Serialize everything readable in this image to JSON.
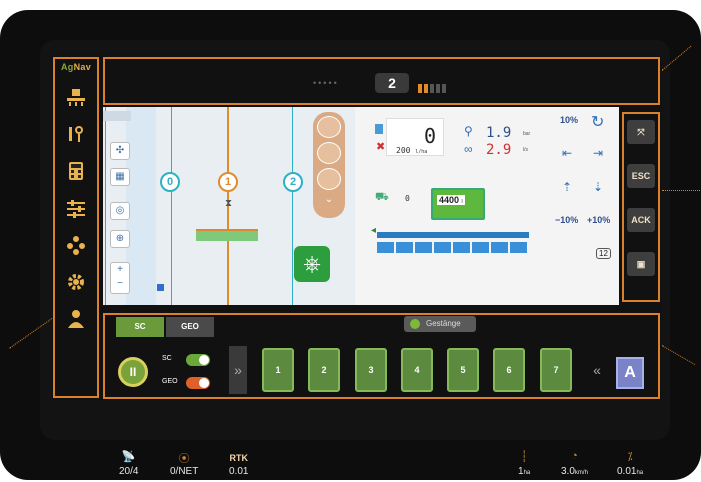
{
  "brand": {
    "logo_left": "Ag",
    "logo_right": "Nav"
  },
  "sidebar": {
    "items": [
      {
        "name": "implement-icon"
      },
      {
        "name": "io-icon"
      },
      {
        "name": "calculator-icon"
      },
      {
        "name": "sliders-icon"
      },
      {
        "name": "nodes-icon"
      },
      {
        "name": "gear-icon"
      },
      {
        "name": "user-icon"
      }
    ]
  },
  "topbar": {
    "satellites": "20/4",
    "ntrip": "0/NET",
    "rtk_label": "RTK",
    "rtk_value": "0.01",
    "lane_number": "2",
    "lane_bars": [
      1,
      1,
      0,
      0,
      0
    ],
    "field_value": "1",
    "field_unit": "ha",
    "speed_value": "3.0",
    "speed_unit": "km/h",
    "rate_value": "0.01",
    "rate_unit": "ha"
  },
  "map": {
    "tracks": [
      "0",
      "1",
      "2"
    ],
    "zoom_in": "+",
    "zoom_out": "−"
  },
  "panel": {
    "total": "0",
    "rate": "200",
    "rate_unit": "l/ha",
    "pressure": "1.9",
    "pressure_unit": "bar",
    "flow": "2.9",
    "flow_unit": "l/s",
    "sections_on": "0",
    "tank_volume": "4400",
    "tank_unit": "l",
    "pct_a": "10%",
    "pct_b": "10%",
    "count": "12"
  },
  "right": {
    "expand": "⤧",
    "esc": "ESC",
    "ack": "ACK",
    "screen": "▣"
  },
  "bottom": {
    "tab_sc": "SC",
    "tab_geo": "GEO",
    "group": "Gestänge",
    "toggle_sc": "SC",
    "toggle_geo": "GEO",
    "play": "II",
    "chev_left": "»",
    "chev_right": "«",
    "sections": [
      "1",
      "2",
      "3",
      "4",
      "5",
      "6",
      "7"
    ],
    "mode": "A"
  },
  "colors": {
    "accent": "#d9822b",
    "section_green": "#5c8a3e",
    "boom_blue": "#2a7bbf",
    "mode_button": "#7b83c8"
  }
}
